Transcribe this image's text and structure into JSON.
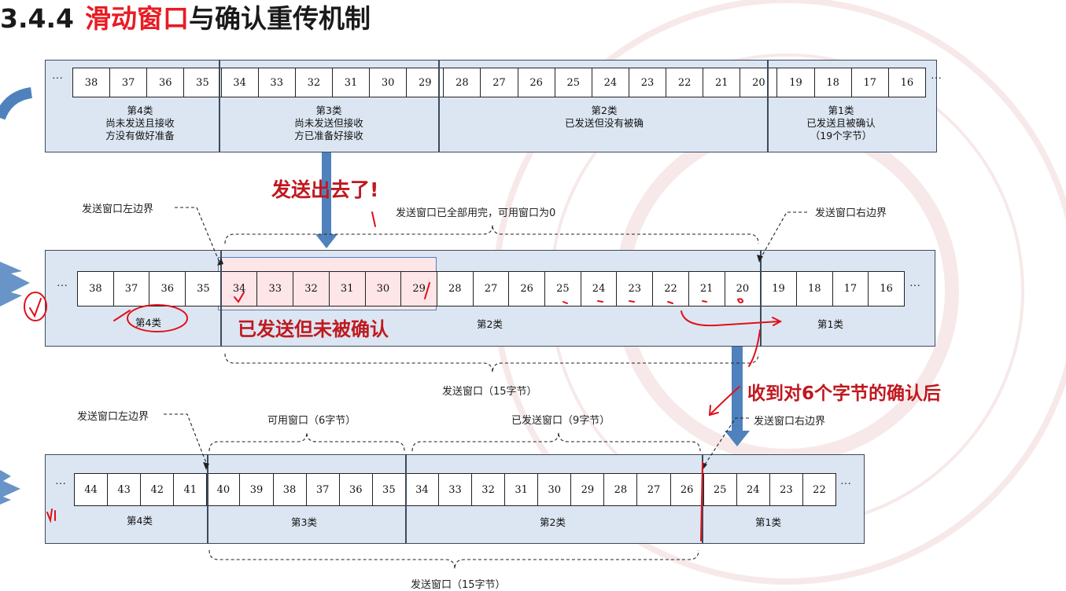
{
  "title": {
    "number": "3.4.4",
    "red_part": "滑动窗口",
    "black_part": "与确认重传机制"
  },
  "ellipsis": "···",
  "diagram1": {
    "seq": [
      "38",
      "37",
      "36",
      "35",
      "34",
      "33",
      "32",
      "31",
      "30",
      "29",
      "28",
      "27",
      "26",
      "25",
      "24",
      "23",
      "22",
      "21",
      "20",
      "19",
      "18",
      "17",
      "16"
    ],
    "categories": [
      {
        "lines": [
          "第4类",
          "尚未发送且接收",
          "方没有做好准备"
        ]
      },
      {
        "lines": [
          "第3类",
          "尚未发送但接收",
          "方已准备好接收"
        ]
      },
      {
        "lines": [
          "第2类",
          "已发送但没有被确"
        ]
      },
      {
        "lines": [
          "第1类",
          "已发送且被确认",
          "（19个字节）"
        ]
      }
    ]
  },
  "diagram2": {
    "seq": [
      "38",
      "37",
      "36",
      "35",
      "34",
      "33",
      "32",
      "31",
      "30",
      "29",
      "28",
      "27",
      "26",
      "25",
      "24",
      "23",
      "22",
      "21",
      "20",
      "19",
      "18",
      "17",
      "16"
    ],
    "categories": [
      "第4类",
      "第2类",
      "第1类"
    ],
    "left_edge_label": "发送窗口左边界",
    "right_edge_label": "发送窗口右边界",
    "top_brace_label": "发送窗口已全部用完，可用窗口为0",
    "bottom_brace_label": "发送窗口（15字节）"
  },
  "diagram3": {
    "seq": [
      "44",
      "43",
      "42",
      "41",
      "40",
      "39",
      "38",
      "37",
      "36",
      "35",
      "34",
      "33",
      "32",
      "31",
      "30",
      "29",
      "28",
      "27",
      "26",
      "25",
      "24",
      "23",
      "22"
    ],
    "categories": [
      "第4类",
      "第3类",
      "第2类",
      "第1类"
    ],
    "left_edge_label": "发送窗口左边界",
    "right_edge_label": "发送窗口右边界",
    "brace_usable": "可用窗口（6字节）",
    "brace_sent": "已发送窗口（9字节）",
    "bottom_brace_label": "发送窗口（15字节）"
  },
  "callouts": {
    "sent_out": "发送出去了!",
    "sent_unacked": "已发送但未被确认",
    "received_ack": "收到对6个字节的确认后"
  },
  "colors": {
    "title_red": "#e81c24",
    "callout_red": "#c0181f",
    "panel_fill": "#dce6f2",
    "arrow_blue": "#4f81bd",
    "highlight_pink": "#fde5e8",
    "ink_red": "#e0101a"
  }
}
